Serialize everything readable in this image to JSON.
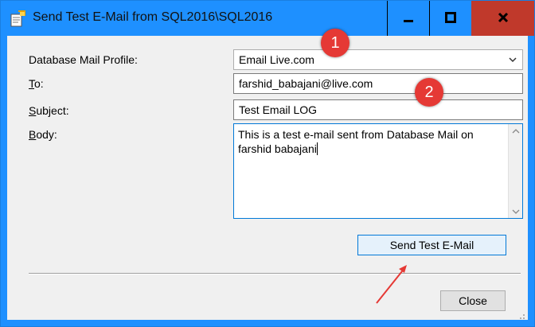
{
  "window": {
    "title": "Send Test E-Mail from SQL2016\\SQL2016",
    "minimize_icon": "minimize-icon",
    "maximize_icon": "maximize-icon",
    "close_icon": "close-icon"
  },
  "form": {
    "profile_label": "Database Mail Profile:",
    "profile_value": "Email Live.com",
    "to_label_access": "T",
    "to_label_rest": "o:",
    "to_value": "farshid_babajani@live.com",
    "subject_label_access": "S",
    "subject_label_rest": "ubject:",
    "subject_value": "Test Email LOG",
    "body_label_access": "B",
    "body_label_rest": "ody:",
    "body_value": "This is a test e-mail sent from Database Mail on farshid babajani"
  },
  "buttons": {
    "send_label": "Send Test E-Mail",
    "close_label": "Close"
  },
  "annotations": {
    "badge_1": "1",
    "badge_2": "2"
  },
  "colors": {
    "titlebar": "#1e90ff",
    "close_button": "#c0392b",
    "badge": "#e53935"
  }
}
